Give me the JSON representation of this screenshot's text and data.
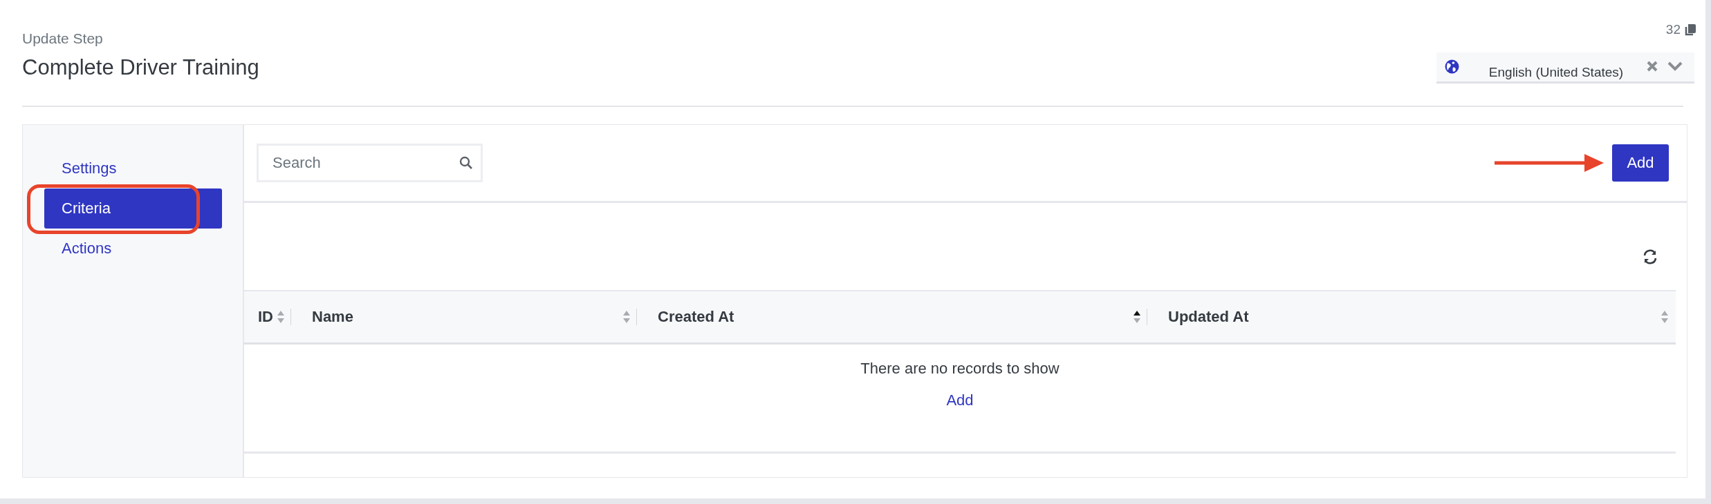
{
  "header": {
    "subtitle": "Update Step",
    "title": "Complete Driver Training",
    "count": "32",
    "language": {
      "value": "English (United States)"
    }
  },
  "sidebar": {
    "items": [
      {
        "label": "Settings",
        "selected": false
      },
      {
        "label": "Criteria",
        "selected": true
      },
      {
        "label": "Actions",
        "selected": false
      }
    ]
  },
  "toolbar": {
    "search": {
      "placeholder": "Search"
    },
    "add_button": "Add"
  },
  "table": {
    "columns": [
      {
        "label": "ID",
        "sorted_ascending": false
      },
      {
        "label": "Name",
        "sorted_ascending": false
      },
      {
        "label": "Created At",
        "sorted_ascending": true
      },
      {
        "label": "Updated At",
        "sorted_ascending": false
      }
    ],
    "empty_message": "There are no records to show",
    "empty_action": "Add"
  }
}
